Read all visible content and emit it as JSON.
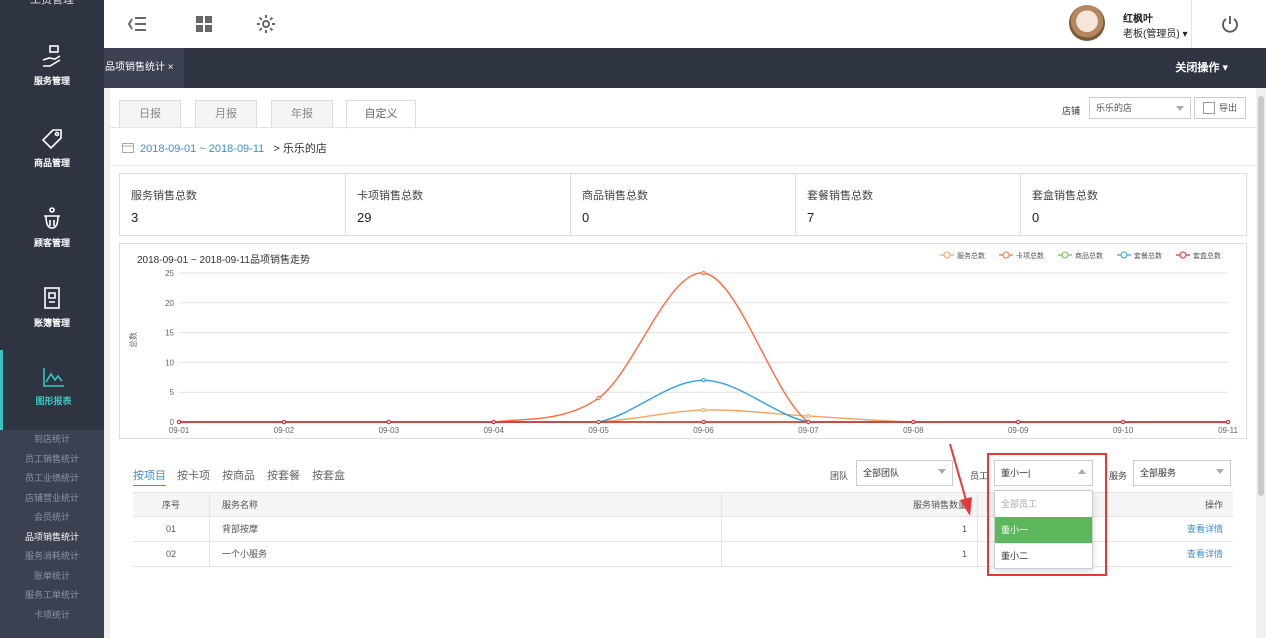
{
  "sidebar": {
    "top_label": "工资管理",
    "items": [
      {
        "label": "服务管理",
        "icon": "hand-heart-icon"
      },
      {
        "label": "商品管理",
        "icon": "sale-tag-icon"
      },
      {
        "label": "顾客管理",
        "icon": "customer-icon"
      },
      {
        "label": "账簿管理",
        "icon": "ledger-icon"
      },
      {
        "label": "图形报表",
        "icon": "line-chart-icon"
      }
    ],
    "submenu": [
      "到店统计",
      "员工销售统计",
      "员工业绩统计",
      "店铺营业统计",
      "会员统计",
      "品项销售统计",
      "服务消耗统计",
      "账单统计",
      "服务工单统计",
      "卡项统计"
    ],
    "submenu_current": "品项销售统计"
  },
  "header": {
    "user_name": "红枫叶",
    "user_role": "老板(管理员) ▾"
  },
  "tabbar": {
    "page_tab": "品项销售统计 ×",
    "close_ops": "关闭操作 ▾"
  },
  "report_tabs": [
    "日报",
    "月报",
    "年报",
    "自定义"
  ],
  "store": {
    "label": "店铺",
    "value": "乐乐的店",
    "export": "导出"
  },
  "range": {
    "text": "2018-09-01 ~ 2018-09-11",
    "arrow": ">",
    "store": "乐乐的店"
  },
  "stats": [
    {
      "title": "服务销售总数",
      "value": "3"
    },
    {
      "title": "卡项销售总数",
      "value": "29"
    },
    {
      "title": "商品销售总数",
      "value": "0"
    },
    {
      "title": "套餐销售总数",
      "value": "7"
    },
    {
      "title": "套盒销售总数",
      "value": "0"
    }
  ],
  "chart_data": {
    "type": "line",
    "title": "2018-09-01 ~ 2018-09-11品项销售走势",
    "ylabel": "总数",
    "ylim": [
      0,
      25
    ],
    "yticks": [
      0,
      5,
      10,
      15,
      20,
      25
    ],
    "x": [
      "09-01",
      "09-02",
      "09-03",
      "09-04",
      "09-05",
      "09-06",
      "09-07",
      "09-08",
      "09-09",
      "09-10",
      "09-11"
    ],
    "legend_position": "top-right",
    "grid": true,
    "series": [
      {
        "name": "服务总数",
        "color": "#f4a460",
        "values": [
          0,
          0,
          0,
          0,
          0,
          2,
          1,
          0,
          0,
          0,
          0
        ]
      },
      {
        "name": "卡项总数",
        "color": "#ff6a3d",
        "values": [
          0,
          0,
          0,
          0,
          4,
          25,
          0,
          0,
          0,
          0,
          0
        ]
      },
      {
        "name": "商品总数",
        "color": "#6cc04a",
        "values": [
          0,
          0,
          0,
          0,
          0,
          0,
          0,
          0,
          0,
          0,
          0
        ]
      },
      {
        "name": "套餐总数",
        "color": "#2d9fe8",
        "values": [
          0,
          0,
          0,
          0,
          0,
          7,
          0,
          0,
          0,
          0,
          0
        ]
      },
      {
        "name": "套盒总数",
        "color": "#e8262a",
        "values": [
          0,
          0,
          0,
          0,
          0,
          0,
          0,
          0,
          0,
          0,
          0
        ]
      }
    ]
  },
  "detail_tabs": [
    "按项目",
    "按卡项",
    "按商品",
    "按套餐",
    "按套盒"
  ],
  "filters": {
    "team_label": "团队",
    "team_value": "全部团队",
    "staff_label": "员工",
    "staff_value": "董小一|",
    "service_label": "服务",
    "service_value": "全部服务"
  },
  "table": {
    "headers": [
      "序号",
      "服务名称",
      "服务销售数量",
      "操作"
    ],
    "rows": [
      {
        "no": "01",
        "name": "背部按摩",
        "qty": "1",
        "action": "查看详情"
      },
      {
        "no": "02",
        "name": "一个小服务",
        "qty": "1",
        "action": "查看详情"
      }
    ]
  },
  "staff_dropdown": {
    "options": [
      "全部员工",
      "董小一",
      "董小二"
    ],
    "selected": "董小一"
  }
}
